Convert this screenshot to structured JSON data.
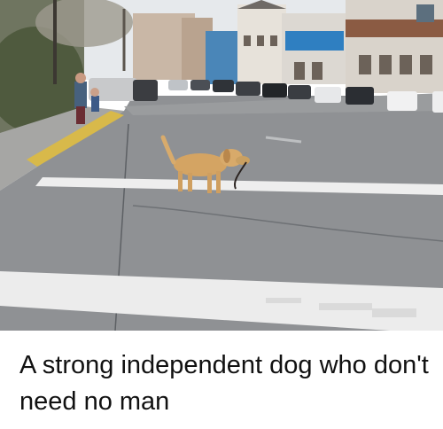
{
  "caption": "A strong independent dog who don't need no man",
  "colors": {
    "road": "#8f9194",
    "crosswalk": "#eeeeee",
    "dog": "#d4a463",
    "sky": "#e6e9ec",
    "caption_text": "#111111"
  },
  "photo": {
    "subject": "golden retriever walking itself across a crosswalk with its leash in its mouth",
    "icons": [
      "dog-figure",
      "leash",
      "parked-cars",
      "storefront-buildings",
      "trees",
      "pedestrians"
    ]
  }
}
